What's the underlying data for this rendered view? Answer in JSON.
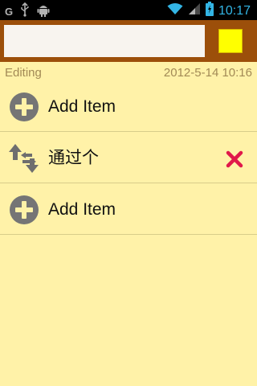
{
  "status_bar": {
    "carrier_glyph": "G",
    "time": "10:17",
    "icons": [
      "usb-icon",
      "android-debug-icon",
      "wifi-icon",
      "signal-icon",
      "battery-charging-icon"
    ]
  },
  "header": {
    "title_value": "",
    "title_placeholder": "",
    "note_color": "#ffff00",
    "bar_color": "#9c4f0a"
  },
  "info": {
    "mode": "Editing",
    "timestamp": "2012-5-14 10:16"
  },
  "list": {
    "items": [
      {
        "label": "Add Item",
        "icon": "add-circle-icon"
      },
      {
        "label": "通过个",
        "icon": "reorder-arrows-icon",
        "action_icon": "delete-x-icon"
      },
      {
        "label": "Add Item",
        "icon": "add-circle-icon"
      }
    ]
  },
  "colors": {
    "background": "#fff2a8",
    "accent_time": "#33b5e5",
    "delete": "#e0194a"
  }
}
